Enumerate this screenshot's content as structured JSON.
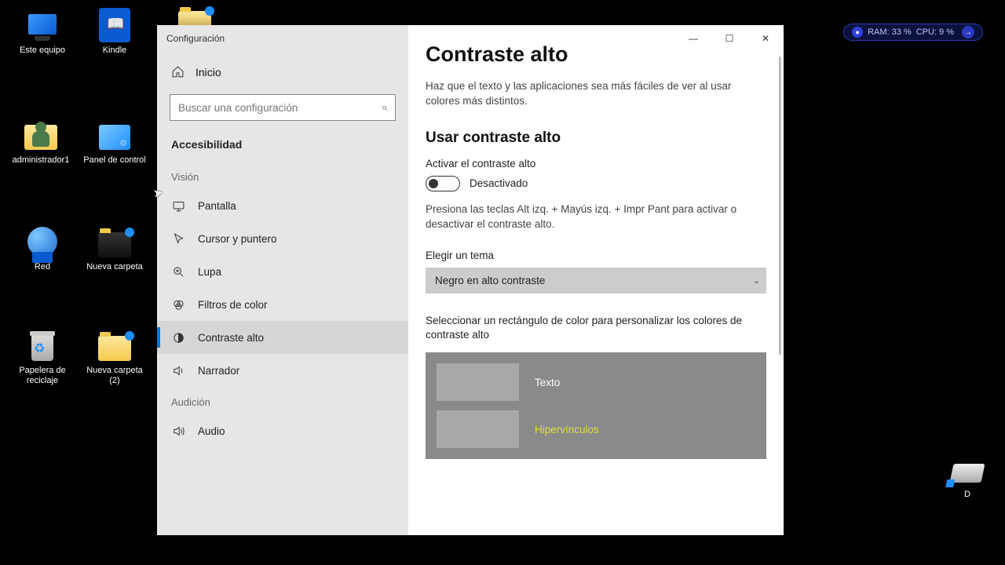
{
  "desktop": {
    "icons": [
      {
        "label": "Este equipo"
      },
      {
        "label": "Kindle"
      },
      {
        "label": "administrador1"
      },
      {
        "label": "Panel de control"
      },
      {
        "label": "Red"
      },
      {
        "label": "Nueva carpeta"
      },
      {
        "label": "Papelera de reciclaje"
      },
      {
        "label": "Nueva carpeta (2)"
      },
      {
        "label": "D"
      }
    ]
  },
  "widget": {
    "ram_label": "RAM: 33 %",
    "cpu_label": "CPU: 9 %"
  },
  "settings": {
    "window_title": "Configuración",
    "home_label": "Inicio",
    "search_placeholder": "Buscar una configuración",
    "category": "Accesibilidad",
    "groups": {
      "vision": "Visión",
      "audicion": "Audición"
    },
    "nav": [
      {
        "label": "Pantalla"
      },
      {
        "label": "Cursor y puntero"
      },
      {
        "label": "Lupa"
      },
      {
        "label": "Filtros de color"
      },
      {
        "label": "Contraste alto"
      },
      {
        "label": "Narrador"
      },
      {
        "label": "Audio"
      }
    ],
    "content": {
      "title": "Contraste alto",
      "description": "Haz que el texto y las aplicaciones sea más fáciles de ver al usar colores más distintos.",
      "section_use": "Usar contraste alto",
      "toggle_label": "Activar el contraste alto",
      "toggle_state": "Desactivado",
      "shortcut_hint": "Presiona las teclas Alt izq. + Mayús izq. + Impr Pant para activar o desactivar el contraste alto.",
      "theme_label": "Elegir un tema",
      "theme_value": "Negro en alto contraste",
      "custom_label": "Seleccionar un rectángulo de color para personalizar los colores de contraste alto",
      "rows": [
        {
          "label": "Texto",
          "className": "clabel"
        },
        {
          "label": "Hipervínculos",
          "className": "clabel hyper"
        }
      ]
    }
  }
}
